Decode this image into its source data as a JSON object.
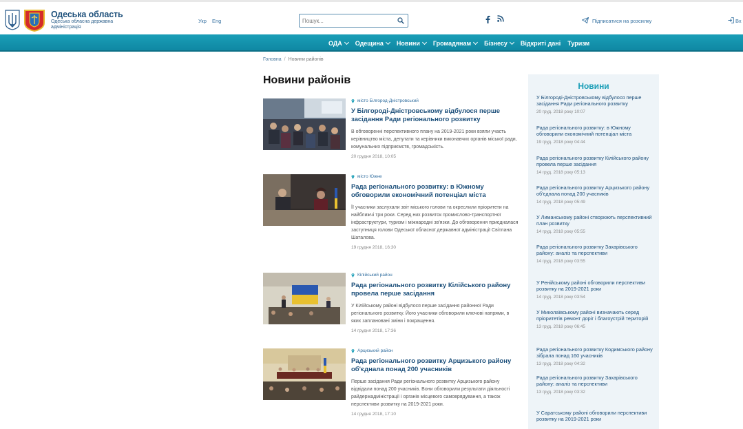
{
  "header": {
    "title": "Одеська область",
    "subtitle": "Одеська обласна державна адміністрація",
    "lang_ukr": "Укр",
    "lang_eng": "Eng",
    "search_placeholder": "Пошук...",
    "subscribe": "Підписатися на розсилку",
    "login": "Вх"
  },
  "nav": {
    "items": [
      {
        "label": "ОДА",
        "dropdown": true
      },
      {
        "label": "Одещина",
        "dropdown": true
      },
      {
        "label": "Новини",
        "dropdown": true
      },
      {
        "label": "Громадянам",
        "dropdown": true
      },
      {
        "label": "Бізнесу",
        "dropdown": true
      },
      {
        "label": "Відкриті дані",
        "dropdown": false
      },
      {
        "label": "Туризм",
        "dropdown": false
      }
    ]
  },
  "breadcrumb": {
    "home": "Головна",
    "current": "Новини районів"
  },
  "page_title": "Новини районів",
  "news": [
    {
      "location": "місто Білгород-Дністровський",
      "title": "У Білгороді-Дністровському відбулося перше засідання Ради регіонального розвитку",
      "text": "В обговоренні перспективного плану на 2019-2021 роки взяли участь керівництво міста, депутати та керівники виконавчих органів міської ради, комунальних підприємств, громадськість.",
      "date": "20 грудня 2018, 10:05"
    },
    {
      "location": "місто Южне",
      "title": "Рада регіонального розвитку: в Южному обговорили економічний потенціал міста",
      "text": "Її учасники заслухали звіт міського голови та окреслили пріоритети на найближчі три роки. Серед них розвиток промислово-транспортної інфраструктури, туризм і міжнародні зв'язки. До обговорення приєдналася заступниця голови Одеської обласної державної адміністрації Світлана Шаталова.",
      "date": "19 грудня 2018, 16:30"
    },
    {
      "location": "Кілійський район",
      "title": "Рада регіонального розвитку Кілійського району провела перше засідання",
      "text": "У Кілійському районі відбулося перше засідання районної Ради регіонального розвитку. Його учасники обговорили ключові напрями, в яких заплановані зміни і покращення.",
      "date": "14 грудня 2018, 17:36"
    },
    {
      "location": "Арцизький район",
      "title": "Рада регіонального розвитку Арцизького району об'єднала понад 200 учасників",
      "text": "Перше засідання Ради регіонального розвитку Арцизького району відвідали понад 200 учасників. Вони обговорили результати діяльності райдержадміністрації і органів місцевого самоврядування, а також перспективи розвитку на 2019-2021 роки.",
      "date": "14 грудня 2018, 17:10"
    }
  ],
  "sidebar": {
    "title": "Новини",
    "items": [
      {
        "title": "У Білгороді-Дністровському відбулося перше засідання Ради регіонального розвитку",
        "date": "20 груд. 2018 року 10:07"
      },
      {
        "title": "Рада регіонального розвитку: в Южному обговорили економічний потенціал міста",
        "date": "19 груд. 2018 року 04:44"
      },
      {
        "title": "Рада регіонального розвитку Кілійського району провела перше засідання",
        "date": "14 груд. 2018 року 05:13"
      },
      {
        "title": "Рада регіонального розвитку Арцизького району об'єднала понад 200 учасників",
        "date": "14 груд. 2018 року 05:49"
      },
      {
        "title": "У Лиманському районі створюють перспективний план розвитку",
        "date": "14 груд. 2018 року 05:55"
      },
      {
        "title": "Рада регіонального розвитку Захарівського району: аналіз та перспективи",
        "date": "14 груд. 2018 року 03:55"
      },
      {
        "title": "У Ренійському районі обговорили перспективи розвитку на 2019-2021 роки",
        "date": "14 груд. 2018 року 03:54"
      },
      {
        "title": "У Миколаївському районі визначають серед пріоритетів ремонт доріг і благоустрій територій",
        "date": "13 груд. 2018 року 06:45"
      },
      {
        "title": "Рада регіонального розвитку Кодимського району зібрала понад 160 учасників",
        "date": "13 груд. 2018 року 04:32"
      },
      {
        "title": "Рада регіонального розвитку Захарівського району: аналіз та перспективи",
        "date": "13 груд. 2018 року 03:32"
      },
      {
        "title": "У Саратському районі обговорили перспективи розвитку на 2019-2021 роки",
        "date": ""
      }
    ]
  },
  "colors": {
    "brand": "#1c4f7a",
    "nav": "#1a9eb7",
    "sidebar_bg": "#eef4f8"
  }
}
